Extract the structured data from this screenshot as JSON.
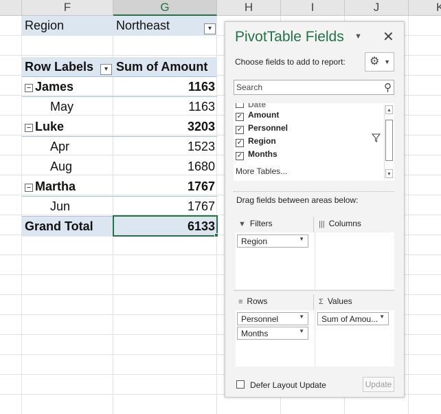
{
  "columns": [
    "F",
    "G",
    "H",
    "I",
    "J",
    "K"
  ],
  "selected_column": "G",
  "filter": {
    "label": "Region",
    "value": "Northeast"
  },
  "pivot": {
    "header_row_labels": "Row Labels",
    "header_sum": "Sum of Amount",
    "rows": [
      {
        "label": "James",
        "value": "1163",
        "level": 0
      },
      {
        "label": "May",
        "value": "1163",
        "level": 1
      },
      {
        "label": "Luke",
        "value": "3203",
        "level": 0
      },
      {
        "label": "Apr",
        "value": "1523",
        "level": 1
      },
      {
        "label": "Aug",
        "value": "1680",
        "level": 1
      },
      {
        "label": "Martha",
        "value": "1767",
        "level": 0
      },
      {
        "label": "Jun",
        "value": "1767",
        "level": 1
      }
    ],
    "grand_total_label": "Grand Total",
    "grand_total_value": "6133"
  },
  "pane": {
    "title": "PivotTable Fields",
    "choose_text": "Choose fields to add to report:",
    "search_placeholder": "Search",
    "fields": [
      {
        "name": "Amount",
        "checked": true
      },
      {
        "name": "Personnel",
        "checked": true
      },
      {
        "name": "Region",
        "checked": true
      },
      {
        "name": "Months",
        "checked": true
      }
    ],
    "more_tables": "More Tables...",
    "drag_text": "Drag fields between areas below:",
    "areas": {
      "filters": {
        "label": "Filters",
        "items": [
          "Region"
        ]
      },
      "columns": {
        "label": "Columns",
        "items": []
      },
      "rows": {
        "label": "Rows",
        "items": [
          "Personnel",
          "Months"
        ]
      },
      "values": {
        "label": "Values",
        "items": [
          "Sum of Amou..."
        ]
      }
    },
    "defer_label": "Defer Layout Update",
    "update_label": "Update"
  },
  "colors": {
    "excel_green": "#217346",
    "pivot_blue": "#dce6f1"
  }
}
